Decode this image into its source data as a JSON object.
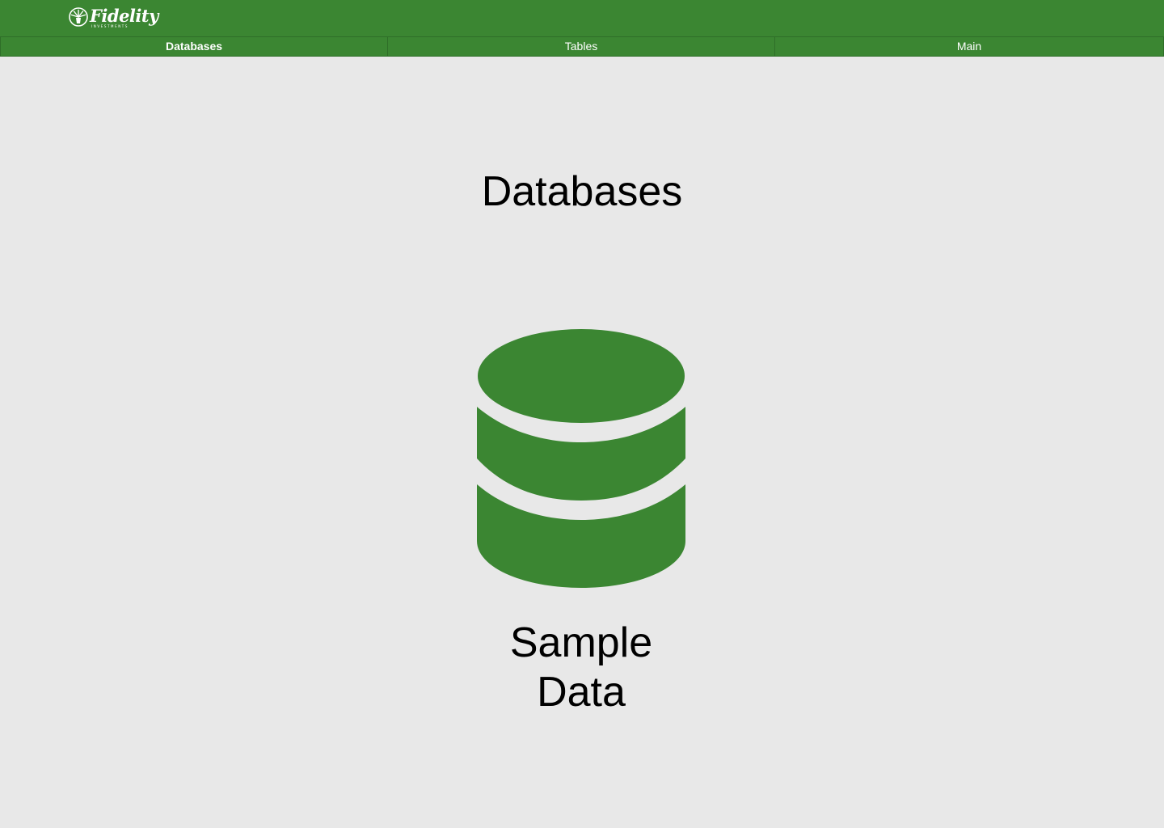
{
  "header": {
    "logo": {
      "name": "Fidelity",
      "subtext": "INVESTMENTS",
      "icon": "fidelity-logo-icon"
    }
  },
  "tabs": [
    {
      "label": "Databases",
      "active": true
    },
    {
      "label": "Tables",
      "active": false
    },
    {
      "label": "Main",
      "active": false
    }
  ],
  "main": {
    "title": "Databases",
    "databases": [
      {
        "name": "Sample\nData",
        "icon": "database-icon"
      }
    ]
  },
  "colors": {
    "brand": "#3b8632",
    "background": "#e8e8e8",
    "text": "#000000"
  }
}
